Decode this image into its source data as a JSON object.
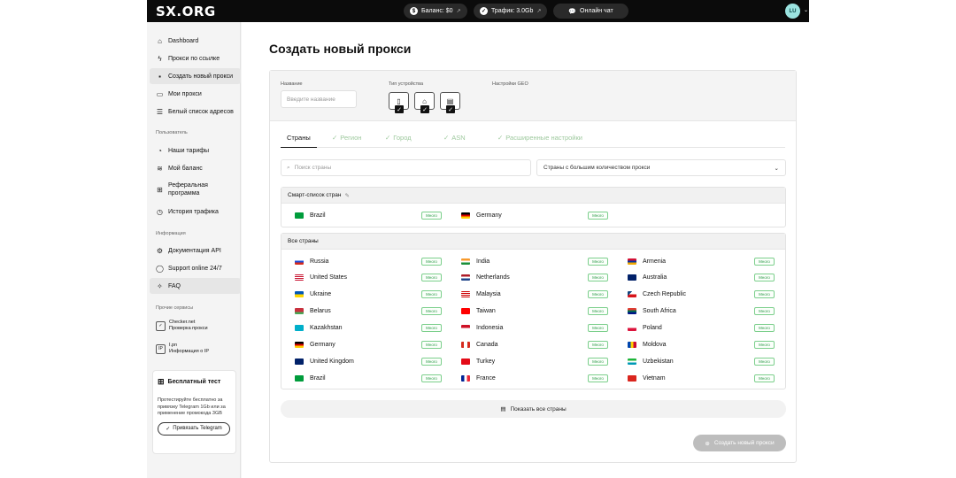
{
  "topbar": {
    "logo": "SX.ORG",
    "balance": "Баланс: $0",
    "traffic": "Трафик: 3.0Gb",
    "chat": "Онлайн чат",
    "avatar": "LU"
  },
  "sidebar": {
    "items": [
      {
        "label": "Dashboard",
        "icon": "home-icon"
      },
      {
        "label": "Прокси по ссылке",
        "icon": "bolt-icon"
      },
      {
        "label": "Создать новый прокси",
        "icon": "file-plus-icon"
      },
      {
        "label": "Мои прокси",
        "icon": "folder-icon"
      },
      {
        "label": "Белый список адресов",
        "icon": "list-icon"
      }
    ],
    "section_user": "Пользователь",
    "user_items": [
      {
        "label": "Наши тарифы",
        "icon": "tariff-icon"
      },
      {
        "label": "Мой баланс",
        "icon": "coins-icon"
      },
      {
        "label": "Реферальная программа",
        "icon": "gift-icon"
      },
      {
        "label": "История трафика",
        "icon": "clock-icon"
      }
    ],
    "section_info": "Информация",
    "info_items": [
      {
        "label": "Документация API",
        "icon": "gear-icon"
      },
      {
        "label": "Support online 24/7",
        "icon": "chat-icon"
      },
      {
        "label": "FAQ",
        "icon": "sparkle-icon"
      }
    ],
    "section_services": "Прочие сервисы",
    "services": [
      {
        "title": "Checker.net",
        "sub": "Проверка прокси"
      },
      {
        "title": "I.pn",
        "sub": "Информация о IP"
      }
    ],
    "promo": {
      "title": "Бесплатный тест",
      "text": "Протестируйте бесплатно за привязку Telegram 1Gb или за применение промокода 3GB",
      "button": "Привязать Telegram"
    }
  },
  "main": {
    "title": "Создать новый прокси",
    "params": {
      "name_label": "Название",
      "name_placeholder": "Введите название",
      "device_label": "Тип устройства",
      "geo_label": "Настройки GEO"
    },
    "tabs": [
      "Страны",
      "Регион",
      "Город",
      "ASN",
      "Расширенные настройки"
    ],
    "search_placeholder": "Поиск страны",
    "select_value": "Страны с большим количеством прокси",
    "smart_list_title": "Смарт-список стран",
    "all_countries_title": "Все страны",
    "badge": "Много",
    "smart_list": [
      {
        "name": "Brazil",
        "flag": "br"
      },
      {
        "name": "Germany",
        "flag": "de"
      }
    ],
    "countries": [
      {
        "name": "Russia",
        "flag": "ru"
      },
      {
        "name": "India",
        "flag": "in"
      },
      {
        "name": "Armenia",
        "flag": "am"
      },
      {
        "name": "United States",
        "flag": "us"
      },
      {
        "name": "Netherlands",
        "flag": "nl"
      },
      {
        "name": "Australia",
        "flag": "au"
      },
      {
        "name": "Ukraine",
        "flag": "ua"
      },
      {
        "name": "Malaysia",
        "flag": "my"
      },
      {
        "name": "Czech Republic",
        "flag": "cz"
      },
      {
        "name": "Belarus",
        "flag": "by"
      },
      {
        "name": "Taiwan",
        "flag": "tw"
      },
      {
        "name": "South Africa",
        "flag": "za"
      },
      {
        "name": "Kazakhstan",
        "flag": "kz"
      },
      {
        "name": "Indonesia",
        "flag": "id"
      },
      {
        "name": "Poland",
        "flag": "pl"
      },
      {
        "name": "Germany",
        "flag": "de"
      },
      {
        "name": "Canada",
        "flag": "ca"
      },
      {
        "name": "Moldova",
        "flag": "md"
      },
      {
        "name": "United Kingdom",
        "flag": "gb"
      },
      {
        "name": "Turkey",
        "flag": "tr"
      },
      {
        "name": "Uzbekistan",
        "flag": "uz"
      },
      {
        "name": "Brazil",
        "flag": "br"
      },
      {
        "name": "France",
        "flag": "fr"
      },
      {
        "name": "Vietnam",
        "flag": "vn"
      }
    ],
    "show_all": "Показать все страны",
    "create_button": "Создать новый прокси"
  },
  "colors": {
    "accent_green": "#2e9b49",
    "topbar_bg": "#0b0b0b",
    "disabled_button": "#bdbdbd"
  }
}
